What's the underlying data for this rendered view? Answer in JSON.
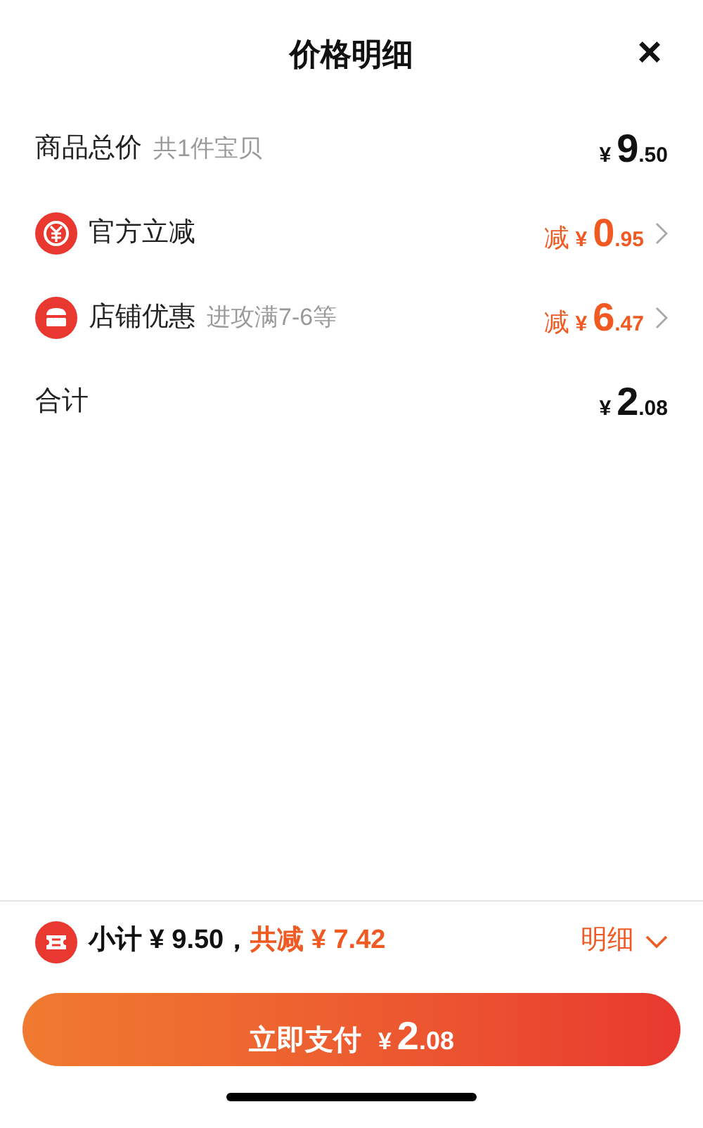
{
  "header": {
    "title": "价格明细",
    "close": "×"
  },
  "rows": [
    {
      "kind": "total",
      "label": "商品总价",
      "note": "共1件宝贝",
      "currency": "¥",
      "integer": "9",
      "decimal": ".50"
    },
    {
      "kind": "discount",
      "label": "官方立减",
      "prefix": "减",
      "currency": "¥",
      "integer": "0",
      "decimal": ".95"
    },
    {
      "kind": "discount",
      "label": "店铺优惠",
      "note": "进攻满7-6等",
      "prefix": "减",
      "currency": "¥",
      "integer": "6",
      "decimal": ".47"
    },
    {
      "kind": "total",
      "label": "合计",
      "currency": "¥",
      "integer": "2",
      "decimal": ".08"
    }
  ],
  "summary": {
    "subtotal": "小计 ¥ 9.50，",
    "saved": "共减 ¥ 7.42",
    "details": "明细"
  },
  "pay_button": {
    "label": "立即支付",
    "currency": "¥",
    "integer": "2",
    "decimal": ".08"
  }
}
